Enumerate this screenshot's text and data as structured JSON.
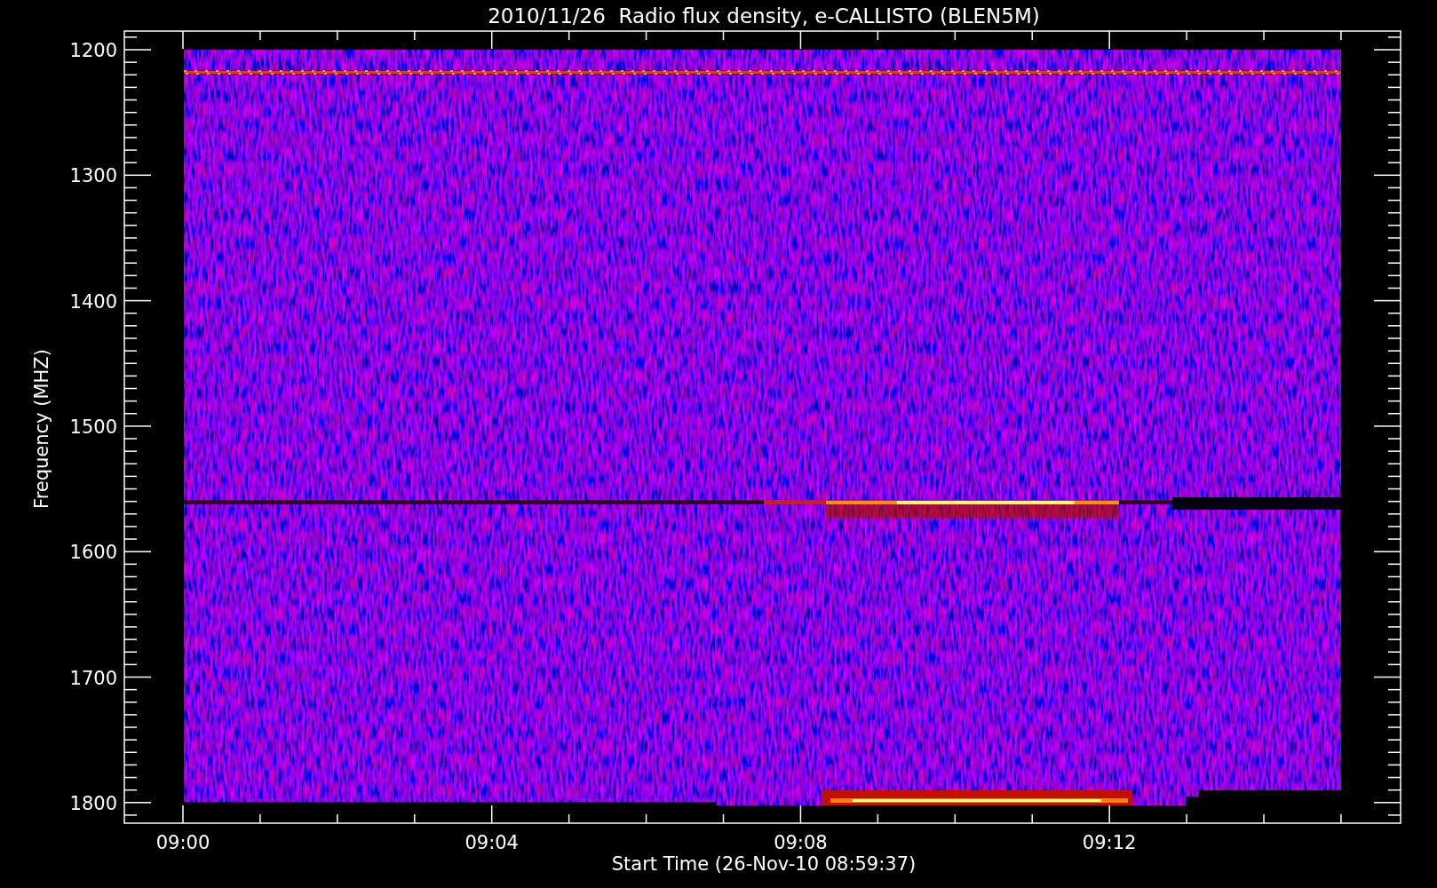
{
  "plot": {
    "title": "2010/11/26  Radio flux density, e-CALLISTO (BLEN5M)",
    "y_axis": {
      "label": "Frequency (MHZ)",
      "ticks": [
        "1200",
        "1300",
        "1400",
        "1500",
        "1600",
        "1700",
        "1800"
      ]
    },
    "x_axis": {
      "label": "Start Time (26-Nov-10 08:59:37)",
      "ticks": [
        "09:00",
        "09:04",
        "09:08",
        "09:12"
      ]
    }
  }
}
